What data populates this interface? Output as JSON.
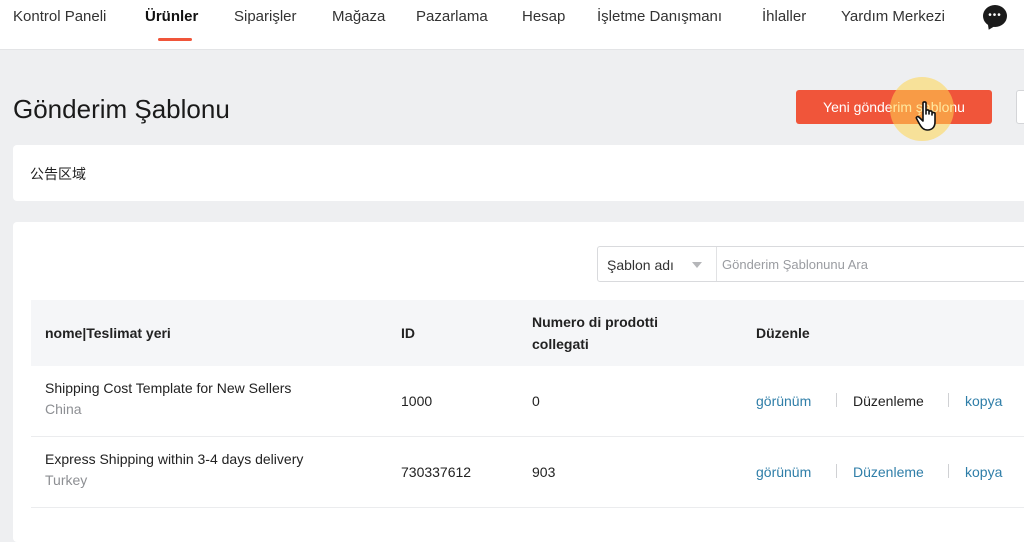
{
  "nav": {
    "items": [
      {
        "label": "Kontrol Paneli"
      },
      {
        "label": "Ürünler"
      },
      {
        "label": "Siparişler"
      },
      {
        "label": "Mağaza"
      },
      {
        "label": "Pazarlama"
      },
      {
        "label": "Hesap"
      },
      {
        "label": "İşletme Danışmanı"
      },
      {
        "label": "İhlaller"
      },
      {
        "label": "Yardım Merkezi"
      }
    ],
    "active_index": 1
  },
  "page": {
    "title": "Gönderim Şablonu",
    "new_template_button": "Yeni gönderim şablonu"
  },
  "notice": {
    "text": "公告区域"
  },
  "search": {
    "field_select": "Şablon adı",
    "placeholder": "Gönderim Şablonunu Ara"
  },
  "table": {
    "headers": {
      "name": "nome|Teslimat yeri",
      "id": "ID",
      "linked_line1": "Numero di prodotti",
      "linked_line2": "collegati",
      "actions": "Düzenle"
    },
    "rows": [
      {
        "name": "Shipping Cost Template for New Sellers",
        "location": "China",
        "id": "1000",
        "count": "0",
        "view": "görünüm",
        "edit": "Düzenleme",
        "copy": "kopya"
      },
      {
        "name": "Express Shipping within 3-4 days delivery",
        "location": "Turkey",
        "id": "730337612",
        "count": "903",
        "view": "görünüm",
        "edit": "Düzenleme",
        "copy": "kopya"
      }
    ]
  },
  "colors": {
    "accent": "#f0553a",
    "link": "#2f7ea8"
  },
  "icons": {
    "chat": "chat-bubble-icon",
    "cursor": "hand-pointer-icon",
    "dropdown": "caret-down-icon"
  }
}
